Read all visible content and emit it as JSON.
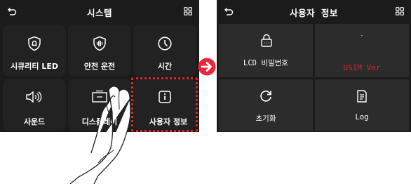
{
  "left_screen": {
    "title": "시스템",
    "back_icon": "back-arrow-icon",
    "grid_icon": "grid-icon",
    "tiles": [
      {
        "label": "시큐리티 LED",
        "icon": "security-bell-icon"
      },
      {
        "label": "안전 운전",
        "icon": "shield-icon"
      },
      {
        "label": "시간",
        "icon": "clock-icon"
      },
      {
        "label": "사운드",
        "icon": "speaker-icon"
      },
      {
        "label": "디스플레이",
        "icon": "display-icon"
      },
      {
        "label": "사용자 정보",
        "icon": "info-icon"
      }
    ],
    "highlighted_tile": "사용자 정보"
  },
  "right_screen": {
    "title": "사용자 정보",
    "back_icon": "back-arrow-icon",
    "grid_icon": "grid-icon",
    "tiles": [
      {
        "label": "LCD 비밀번호",
        "icon": "lock-icon"
      },
      {
        "value": "-",
        "label": "USIM Ver"
      },
      {
        "label": "초기화",
        "icon": "reset-icon"
      },
      {
        "label": "Log",
        "icon": "document-icon"
      }
    ]
  },
  "colors": {
    "screen_bg": "#1b1b1b",
    "tile_bg": "#222222",
    "highlight": "#d8262f",
    "usim_text": "#d8262f",
    "arrow": "#e8283a"
  }
}
